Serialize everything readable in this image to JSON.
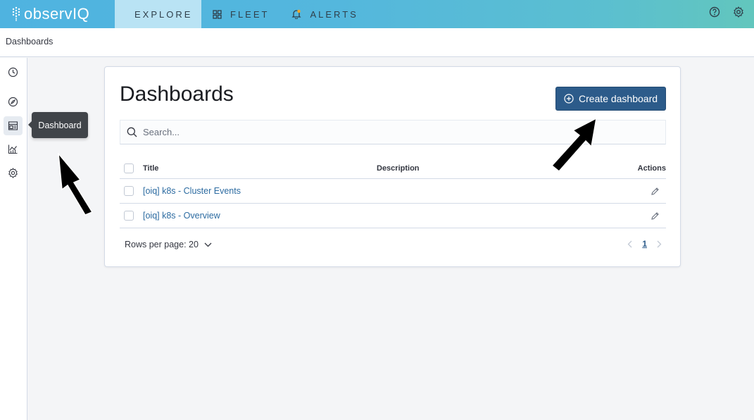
{
  "app": {
    "logo_text": "observIQ"
  },
  "nav": [
    {
      "label": "EXPLORE",
      "icon": "bar-chart-icon",
      "active": true
    },
    {
      "label": "FLEET",
      "icon": "grid-icon",
      "active": false
    },
    {
      "label": "ALERTS",
      "icon": "bell-icon",
      "active": false
    }
  ],
  "header_icons": [
    "help-icon",
    "gear-icon"
  ],
  "breadcrumb": "Dashboards",
  "sidenav": [
    "clock-icon",
    "compass-icon",
    "dashboard-icon",
    "visualize-icon",
    "settings-icon"
  ],
  "tooltip": "Dashboard",
  "main": {
    "title": "Dashboards",
    "create_button": "Create dashboard",
    "search_placeholder": "Search...",
    "columns": {
      "title": "Title",
      "description": "Description",
      "actions": "Actions"
    },
    "rows": [
      {
        "title": "[oiq] k8s - Cluster Events",
        "description": ""
      },
      {
        "title": "[oiq] k8s - Overview",
        "description": ""
      }
    ],
    "rows_per_page": "Rows per page: 20",
    "page": "1"
  },
  "colors": {
    "accent": "#2c5b8a",
    "link": "#2c6ba1",
    "topbar": "#4fb3e0"
  }
}
